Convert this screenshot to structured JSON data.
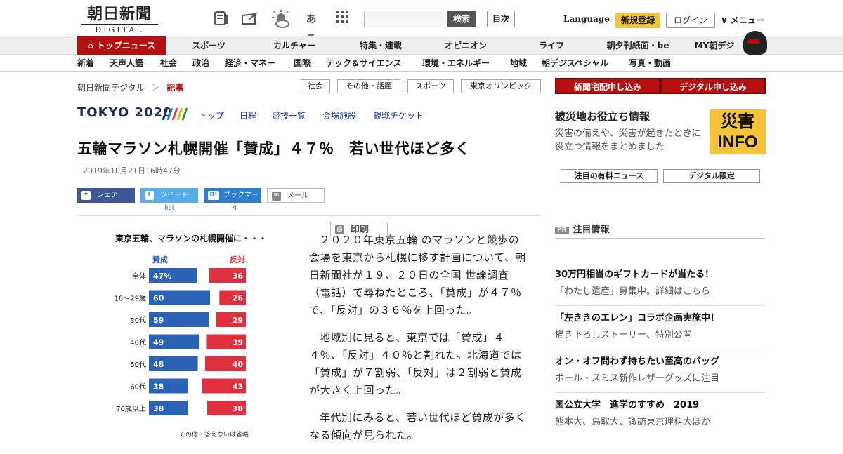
{
  "header": {
    "logo_jp": "朝日新聞",
    "logo_en": "DIGITAL",
    "search_button": "検索",
    "toc_button": "目次",
    "language": "Language",
    "register": "新規登録",
    "login": "ログイン",
    "menu": "∨ メニュー",
    "aa_label": "あぁ"
  },
  "nav_primary": [
    "トップニュース",
    "スポーツ",
    "カルチャー",
    "特集・連載",
    "オピニオン",
    "ライフ",
    "朝夕刊紙面・be",
    "MY朝デジ"
  ],
  "nav_secondary": [
    "新着",
    "天声人語",
    "社会",
    "政治",
    "経済・マネー",
    "国際",
    "テック＆サイエンス",
    "環境・エネルギー",
    "地域",
    "朝デジスペシャル",
    "写真・動画"
  ],
  "breadcrumb": {
    "home": "朝日新聞デジタル",
    "sep": "＞",
    "current": "記事"
  },
  "tags": [
    "社会",
    "その他・話題",
    "スポーツ",
    "東京オリンピック"
  ],
  "olympic": {
    "logo": "TOKYO 2020",
    "links": [
      "トップ",
      "日程",
      "競技一覧",
      "会場施設",
      "観戦チケット"
    ]
  },
  "article": {
    "title": "五輪マラソン札幌開催「賛成」４７％　若い世代ほど多く",
    "date": "2019年10月21日16時47分",
    "paragraphs": [
      "２０２０年東京五輪 のマラソンと競歩の会場を東京から札幌に移す計画について、朝日新聞社が１９、２０日の全国 世論調査 （電話）で尋ねたところ、「賛成」が４７％で、「反対」の３６％を上回った。",
      "地域別に見ると、東京では「賛成」４４％、「反対」４０％と割れた。北海道では「賛成」が７割弱、「反対」は２割弱と賛成が大きく上回った。",
      "年代別にみると、若い世代ほど賛成が多くなる傾向が見られた。"
    ]
  },
  "share": {
    "facebook": "シェア",
    "twitter": "ツイート",
    "hatena": "ブックマーク",
    "mail": "メール",
    "print": "印刷",
    "twitter_count": "list",
    "hatena_count": "4",
    "hatena_icon": "B!"
  },
  "chart_data": {
    "type": "bar",
    "title": "東京五輪、マラソンの札幌開催に・・・",
    "series": [
      {
        "name": "賛成",
        "values": [
          47,
          60,
          59,
          49,
          48,
          38,
          38
        ],
        "color": "#2a62b5"
      },
      {
        "name": "反対",
        "values": [
          36,
          26,
          29,
          39,
          40,
          43,
          38
        ],
        "color": "#e0303d"
      }
    ],
    "categories": [
      "全体",
      "18〜29歳",
      "30代",
      "40代",
      "50代",
      "60代",
      "70歳以上"
    ],
    "value_labels_first": [
      "47%",
      "60",
      "59",
      "49",
      "48",
      "38",
      "38"
    ],
    "value_labels_second": [
      "36",
      "26",
      "29",
      "39",
      "40",
      "43",
      "38"
    ],
    "note": "その他・答えないは省略"
  },
  "sidebar": {
    "btn_newspaper": "新聞宅配申し込み",
    "btn_digital": "デジタル申し込み",
    "disaster_title": "被災地お役立ち情報",
    "disaster_desc": "災害の備えや、災害が起きたときに役立つ情報をまとめました",
    "info_line1": "災害",
    "info_line2": "INFO",
    "btn_paid": "注目の有料ニュース",
    "btn_limited": "デジタル限定",
    "pr_badge": "PR",
    "pr_title": "注目情報",
    "promos": [
      {
        "h": "30万円相当のギフトカードが当たる！",
        "d": "「わたし遺産」募集中。詳細はこちら"
      },
      {
        "h": "「左ききのエレン」コラボ企画実施中！",
        "d": "描き下ろしストーリー、特別公開"
      },
      {
        "h": "オン・オフ問わず持ちたい至高のバッグ",
        "d": "ポール・スミス新作レザーグッズに注目"
      },
      {
        "h": "国公立大学　進学のすすめ　2019",
        "d": "熊本大、鳥取大、諏訪東京理科大ほか"
      }
    ]
  }
}
